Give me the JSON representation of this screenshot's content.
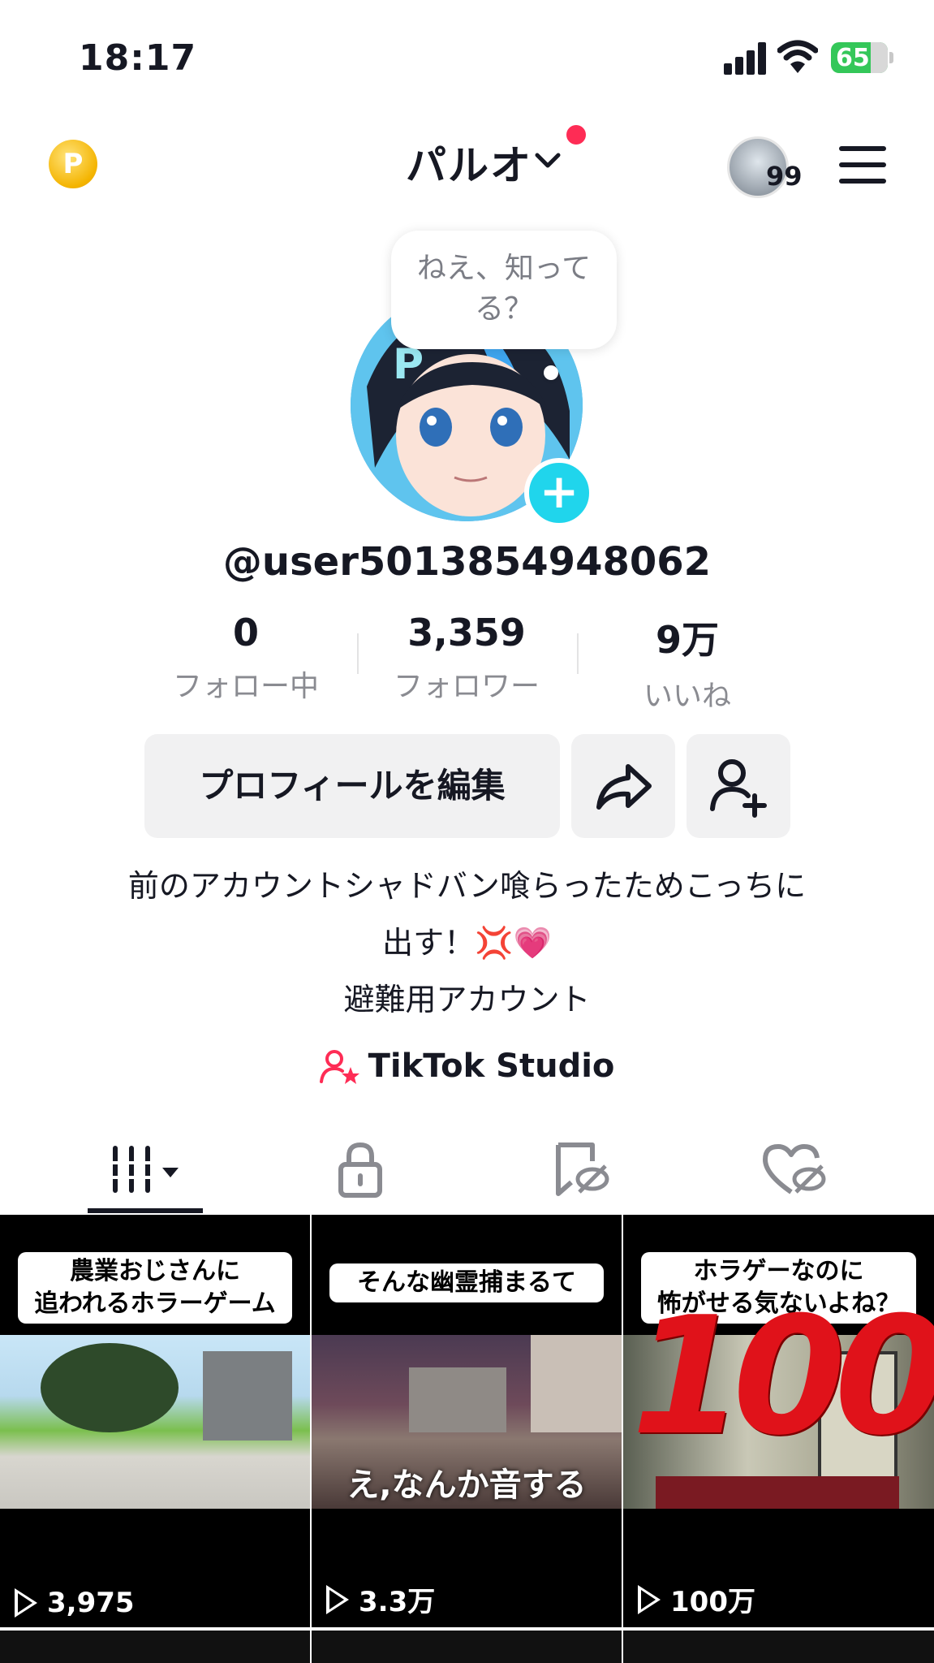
{
  "status_bar": {
    "time": "18:17",
    "battery": "65"
  },
  "header": {
    "username": "パルオ",
    "story_count": "99",
    "coin_label": "P"
  },
  "profile": {
    "bubble_text": "ねえ、知ってる？",
    "handle": "@user5013854948062",
    "stats": [
      {
        "value": "0",
        "label": "フォロー中"
      },
      {
        "value": "3,359",
        "label": "フォロワー"
      },
      {
        "value": "9万",
        "label": "いいね"
      }
    ],
    "edit_button": "プロフィールを編集",
    "bio_lines": [
      "前のアカウントシャドバン喰らったためこっちに",
      "出す！💢💗",
      "避難用アカウント"
    ],
    "studio_label": "TikTok Studio"
  },
  "tabs": [
    {
      "name": "videos",
      "icon": "grid-icon"
    },
    {
      "name": "private",
      "icon": "lock-icon"
    },
    {
      "name": "reposts",
      "icon": "repost-hidden-icon"
    },
    {
      "name": "liked",
      "icon": "heart-hidden-icon"
    }
  ],
  "videos": [
    {
      "caption": "農業おじさんに\n追われるホラーゲーム",
      "views": "3,975"
    },
    {
      "caption": "そんな幽霊捕まるて",
      "overlay": "え,なんか音する",
      "views": "3.3万"
    },
    {
      "caption": "ホラゲーなのに\n怖がせる気ないよね？",
      "sticker": "100",
      "views": "100万"
    }
  ],
  "colors": {
    "accent": "#fe2c55",
    "plus": "#20d5ec",
    "battery": "#34c759"
  }
}
